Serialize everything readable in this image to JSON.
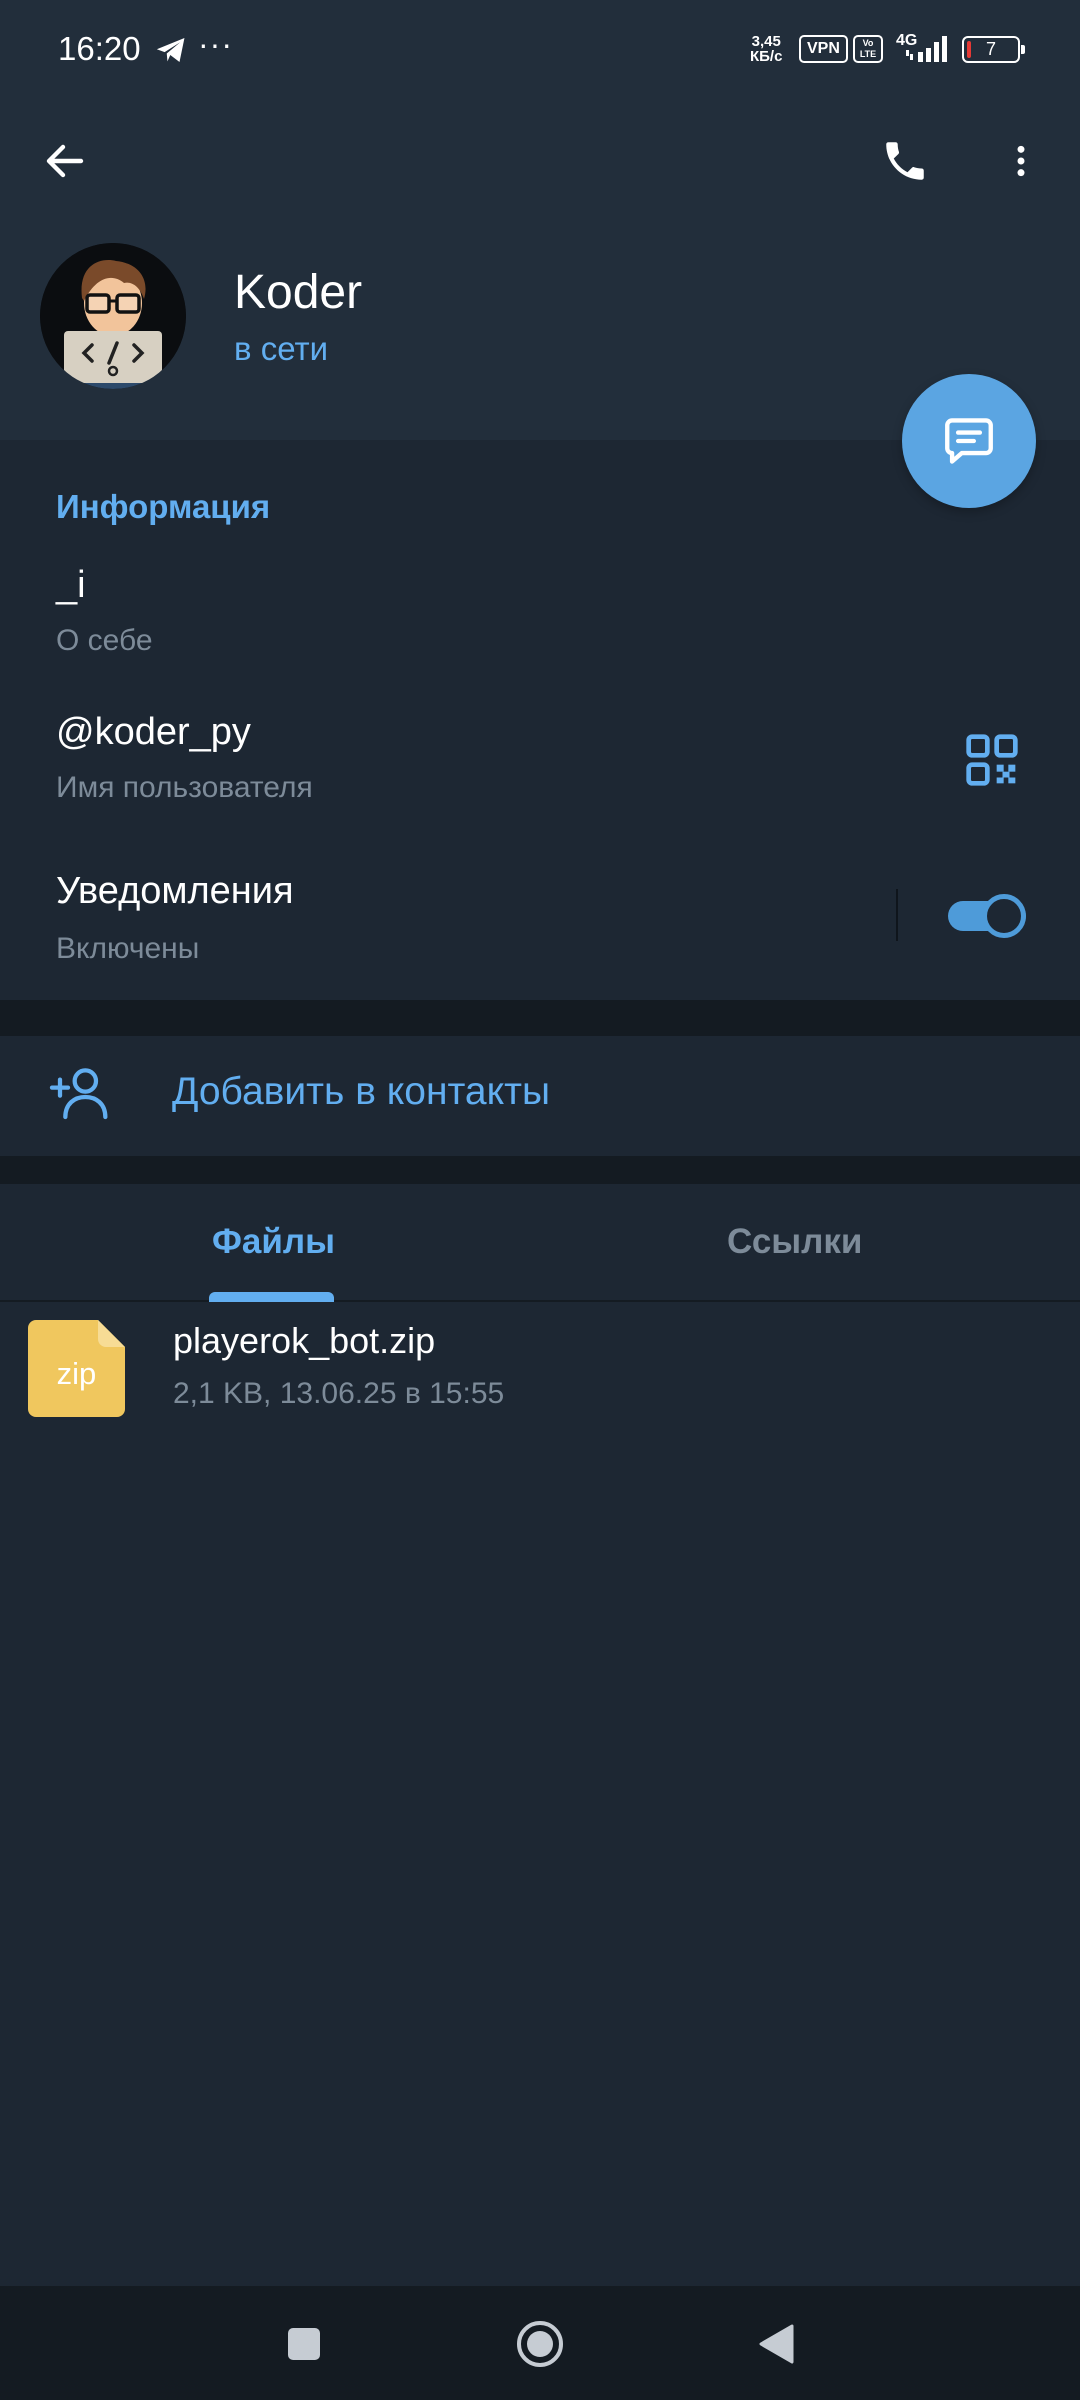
{
  "status_bar": {
    "time": "16:20",
    "more": "···",
    "speed_value": "3,45",
    "speed_unit": "КБ/с",
    "vpn": "VPN",
    "volte_top": "Vo",
    "volte_bottom": "LTE",
    "network": "4G",
    "battery": "7"
  },
  "toolbar": {
    "back_icon": "arrow-left",
    "call_icon": "phone",
    "menu_icon": "dots-vertical"
  },
  "profile": {
    "name": "Koder",
    "status": "в сети",
    "avatar_icon": "coder-avatar"
  },
  "fab": {
    "icon": "message"
  },
  "info": {
    "title": "Информация",
    "bio_value": "_i",
    "bio_caption": "О себе",
    "username_value": "@koder_py",
    "username_caption": "Имя пользователя",
    "notifications_value": "Уведомления",
    "notifications_caption": "Включены",
    "notifications_enabled": true
  },
  "add_contact": {
    "label": "Добавить в контакты"
  },
  "tabs": [
    {
      "label": "Файлы",
      "active": true
    },
    {
      "label": "Ссылки",
      "active": false
    }
  ],
  "files": [
    {
      "icon_label": "zip",
      "name": "playerok_bot.zip",
      "meta": "2,1 KB, 13.06.25 в 15:55"
    }
  ],
  "colors": {
    "accent": "#62aef0",
    "header_bg": "#222e3b",
    "body_bg": "#1d2733",
    "secondary_text": "#7d8b99",
    "file_icon": "#f0c75e"
  }
}
